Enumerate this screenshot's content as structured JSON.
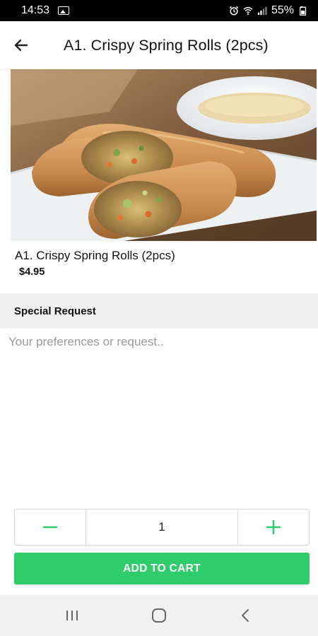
{
  "status_bar": {
    "time": "14:53",
    "battery": "55%"
  },
  "header": {
    "title": "A1. Crispy Spring Rolls (2pcs)"
  },
  "item": {
    "name": "A1. Crispy Spring Rolls (2pcs)",
    "price": "$4.95"
  },
  "special_request": {
    "heading": "Special Request",
    "placeholder": "Your preferences or request.."
  },
  "quantity": {
    "value": "1"
  },
  "add_to_cart": {
    "label": "ADD TO CART"
  },
  "colors": {
    "accent": "#2ecc6a",
    "section_bg": "#efefef",
    "nav_bg": "#f1f1f1"
  },
  "icons": [
    "image-icon",
    "alarm-icon",
    "wifi-icon",
    "signal-icon",
    "battery-icon",
    "back-arrow-icon",
    "minus-icon",
    "plus-icon",
    "recents-icon",
    "home-icon",
    "back-icon"
  ]
}
